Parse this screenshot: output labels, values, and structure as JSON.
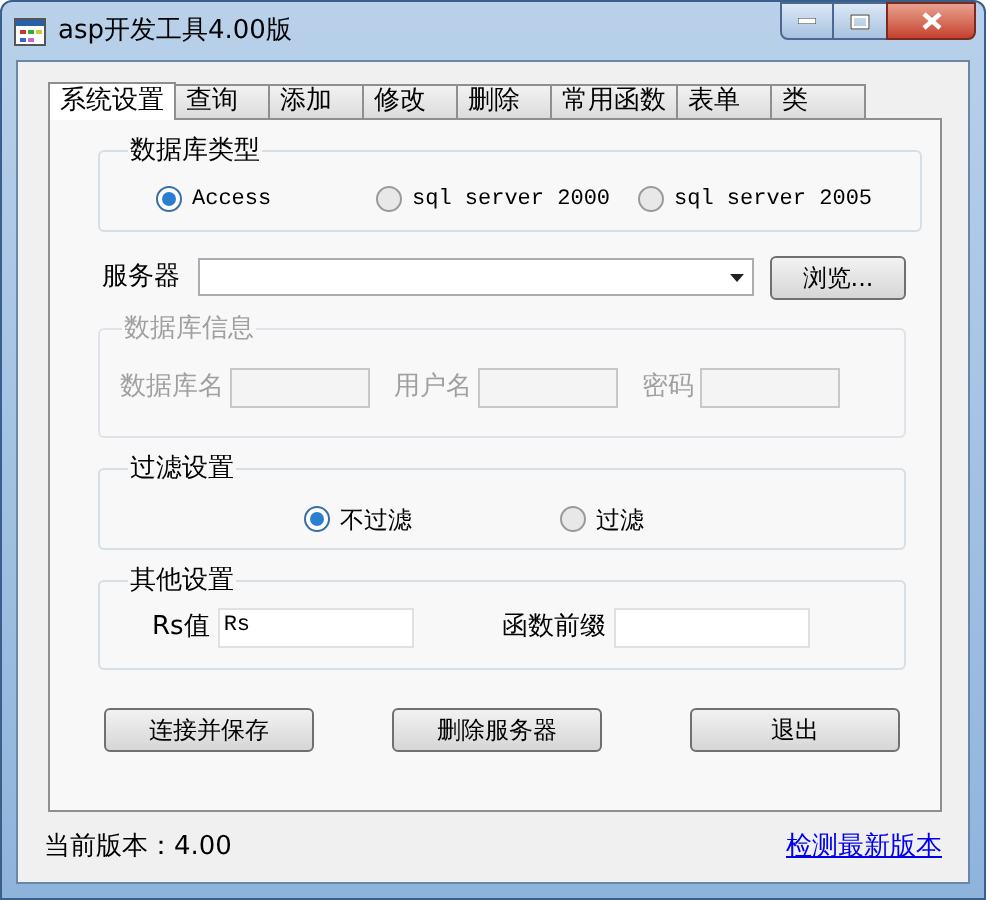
{
  "window": {
    "title": "asp开发工具4.00版"
  },
  "tabs": [
    {
      "label": "系统设置",
      "selected": true
    },
    {
      "label": "查询",
      "selected": false
    },
    {
      "label": "添加",
      "selected": false
    },
    {
      "label": "修改",
      "selected": false
    },
    {
      "label": "删除",
      "selected": false
    },
    {
      "label": "常用函数",
      "selected": false
    },
    {
      "label": "表单",
      "selected": false
    },
    {
      "label": "类",
      "selected": false
    }
  ],
  "db_type": {
    "title": "数据库类型",
    "options": [
      {
        "label": "Access",
        "selected": true
      },
      {
        "label": "sql server 2000",
        "selected": false
      },
      {
        "label": "sql server 2005",
        "selected": false
      }
    ]
  },
  "server": {
    "label": "服务器",
    "browse_button": "浏览..."
  },
  "db_info": {
    "title": "数据库信息",
    "disabled": true,
    "fields": [
      {
        "label": "数据库名"
      },
      {
        "label": "用户名"
      },
      {
        "label": "密码"
      }
    ]
  },
  "filter": {
    "title": "过滤设置",
    "options": [
      {
        "label": "不过滤",
        "selected": true
      },
      {
        "label": "过滤",
        "selected": false
      }
    ]
  },
  "other": {
    "title": "其他设置",
    "fields": [
      {
        "label": "Rs值",
        "value": "Rs"
      },
      {
        "label": "函数前缀"
      }
    ]
  },
  "buttons": [
    {
      "label": "连接并保存"
    },
    {
      "label": "删除服务器"
    },
    {
      "label": "退出"
    }
  ],
  "status": {
    "version": "当前版本：4.00",
    "link": "检测最新版本"
  }
}
